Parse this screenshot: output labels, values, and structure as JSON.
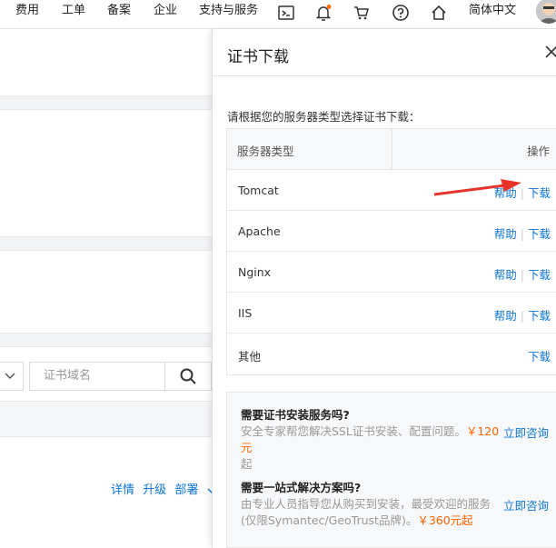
{
  "nav": {
    "items": [
      "费用",
      "工单",
      "备案",
      "企业",
      "支持与服务"
    ],
    "lang": "简体中文",
    "icons": [
      "terminal-icon",
      "bell-icon",
      "cart-icon",
      "help-icon",
      "home-icon"
    ]
  },
  "background": {
    "search_placeholder": "证书域名",
    "actions": [
      "详情",
      "升级",
      "部署"
    ]
  },
  "drawer": {
    "title": "证书下载",
    "description": "请根据您的服务器类型选择证书下载：",
    "table": {
      "col_server": "服务器类型",
      "col_action": "操作",
      "help_label": "帮助",
      "download_label": "下载",
      "rows": [
        {
          "name": "Tomcat",
          "help": "帮助",
          "download": "下载"
        },
        {
          "name": "Apache",
          "help": "帮助",
          "download": "下载"
        },
        {
          "name": "Nginx",
          "help": "帮助",
          "download": "下载"
        },
        {
          "name": "IIS",
          "help": "帮助",
          "download": "下载"
        },
        {
          "name": "其他",
          "help": "",
          "download": "下载"
        }
      ]
    },
    "info": {
      "install_title": "需要证书安装服务吗?",
      "install_text_a": "安全专家帮您解决SSL证书安装、配置问题。",
      "install_price": "￥120元",
      "install_text_b": "起",
      "install_link": "立即咨询",
      "solution_title": "需要一站式解决方案吗?",
      "solution_text_a": "由专业人员指导您从购买到安装，最受欢迎的服务(仅限Symantec/GeoTrust品牌)。",
      "solution_price": "￥360元起",
      "solution_link": "立即咨询"
    }
  },
  "colors": {
    "link": "#0d74d4",
    "price": "#ff6600",
    "annotation_arrow": "#e8332a"
  }
}
